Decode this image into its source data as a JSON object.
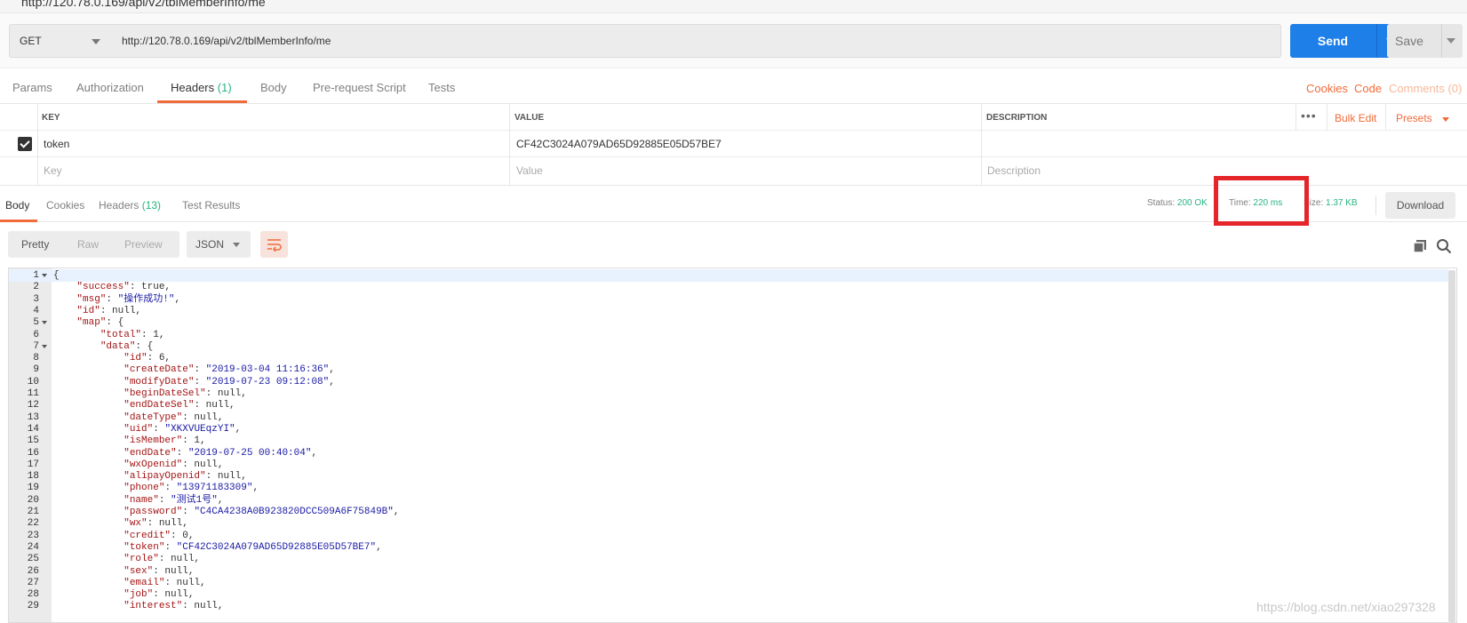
{
  "title_url": "http://120.78.0.169/api/v2/tblMemberInfo/me",
  "request": {
    "method": "GET",
    "url": "http://120.78.0.169/api/v2/tblMemberInfo/me",
    "send_label": "Send",
    "save_label": "Save"
  },
  "req_tabs": {
    "params": "Params",
    "authorization": "Authorization",
    "headers": "Headers",
    "headers_count": "(1)",
    "body": "Body",
    "prerequest": "Pre-request Script",
    "tests": "Tests",
    "cookies": "Cookies",
    "code": "Code",
    "comments": "Comments (0)"
  },
  "headers_table": {
    "col_key": "KEY",
    "col_value": "VALUE",
    "col_description": "DESCRIPTION",
    "more": "•••",
    "bulk_edit": "Bulk Edit",
    "presets": "Presets",
    "rows": [
      {
        "key": "token",
        "value": "CF42C3024A079AD65D92885E05D57BE7",
        "checked": true
      }
    ],
    "placeholders": {
      "key": "Key",
      "value": "Value",
      "description": "Description"
    }
  },
  "resp_tabs": {
    "body": "Body",
    "cookies": "Cookies",
    "headers": "Headers",
    "headers_count": "(13)",
    "test_results": "Test Results"
  },
  "response_meta": {
    "status_label": "Status:",
    "status_value": "200 OK",
    "time_label": "Time:",
    "time_value": "220 ms",
    "size_label": "Size:",
    "size_value": "1.37 KB",
    "download": "Download"
  },
  "view": {
    "pretty": "Pretty",
    "raw": "Raw",
    "preview": "Preview",
    "format": "JSON"
  },
  "colors": {
    "accent": "#f26b3a",
    "send": "#1e7fe8",
    "success": "#26b47f",
    "highlight": "#e4262a"
  },
  "code_lines": [
    {
      "n": "1",
      "text": "{"
    },
    {
      "n": "2",
      "text": "    \"success\": true,"
    },
    {
      "n": "3",
      "text": "    \"msg\": \"操作成功!\","
    },
    {
      "n": "4",
      "text": "    \"id\": null,"
    },
    {
      "n": "5",
      "text": "    \"map\": {"
    },
    {
      "n": "6",
      "text": "        \"total\": 1,"
    },
    {
      "n": "7",
      "text": "        \"data\": {"
    },
    {
      "n": "8",
      "text": "            \"id\": 6,"
    },
    {
      "n": "9",
      "text": "            \"createDate\": \"2019-03-04 11:16:36\","
    },
    {
      "n": "10",
      "text": "            \"modifyDate\": \"2019-07-23 09:12:08\","
    },
    {
      "n": "11",
      "text": "            \"beginDateSel\": null,"
    },
    {
      "n": "12",
      "text": "            \"endDateSel\": null,"
    },
    {
      "n": "13",
      "text": "            \"dateType\": null,"
    },
    {
      "n": "14",
      "text": "            \"uid\": \"XKXVUEqzYI\","
    },
    {
      "n": "15",
      "text": "            \"isMember\": 1,"
    },
    {
      "n": "16",
      "text": "            \"endDate\": \"2019-07-25 00:40:04\","
    },
    {
      "n": "17",
      "text": "            \"wxOpenid\": null,"
    },
    {
      "n": "18",
      "text": "            \"alipayOpenid\": null,"
    },
    {
      "n": "19",
      "text": "            \"phone\": \"13971183309\","
    },
    {
      "n": "20",
      "text": "            \"name\": \"测试1号\","
    },
    {
      "n": "21",
      "text": "            \"password\": \"C4CA4238A0B923820DCC509A6F75849B\","
    },
    {
      "n": "22",
      "text": "            \"wx\": null,"
    },
    {
      "n": "23",
      "text": "            \"credit\": 0,"
    },
    {
      "n": "24",
      "text": "            \"token\": \"CF42C3024A079AD65D92885E05D57BE7\","
    },
    {
      "n": "25",
      "text": "            \"role\": null,"
    },
    {
      "n": "26",
      "text": "            \"sex\": null,"
    },
    {
      "n": "27",
      "text": "            \"email\": null,"
    },
    {
      "n": "28",
      "text": "            \"job\": null,"
    },
    {
      "n": "29",
      "text": "            \"interest\": null,"
    }
  ],
  "watermark": "https://blog.csdn.net/xiao297328"
}
